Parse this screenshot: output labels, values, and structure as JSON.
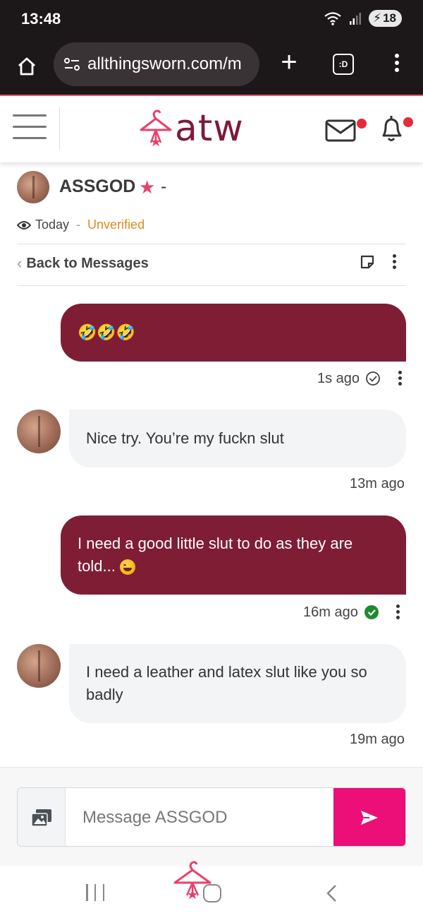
{
  "status_bar": {
    "time": "13:48",
    "battery": "18"
  },
  "browser": {
    "url": "allthingsworn.com/m",
    "tabs_label": ":D"
  },
  "site": {
    "logo_text": "atw",
    "brand_color": "#7d1a37",
    "accent_color": "#eb0f77"
  },
  "conversation": {
    "username": "ASSGOD",
    "star": "★",
    "dash": "-",
    "seen": "Today",
    "separator": "-",
    "verification": "Unverified",
    "back_label": "Back to Messages"
  },
  "messages": [
    {
      "direction": "out",
      "text": "🤣🤣🤣",
      "time": "1s ago",
      "status": "sent"
    },
    {
      "direction": "in",
      "text": "Nice try. You’re my fuckn slut",
      "time": "13m ago"
    },
    {
      "direction": "out",
      "text": "I need a good little slut to do as they are told...",
      "emoji": "😉",
      "time": "16m ago",
      "status": "read"
    },
    {
      "direction": "in",
      "text": "I need a leather and latex slut like you so badly",
      "time": "19m ago"
    }
  ],
  "composer": {
    "placeholder": "Message ASSGOD"
  }
}
